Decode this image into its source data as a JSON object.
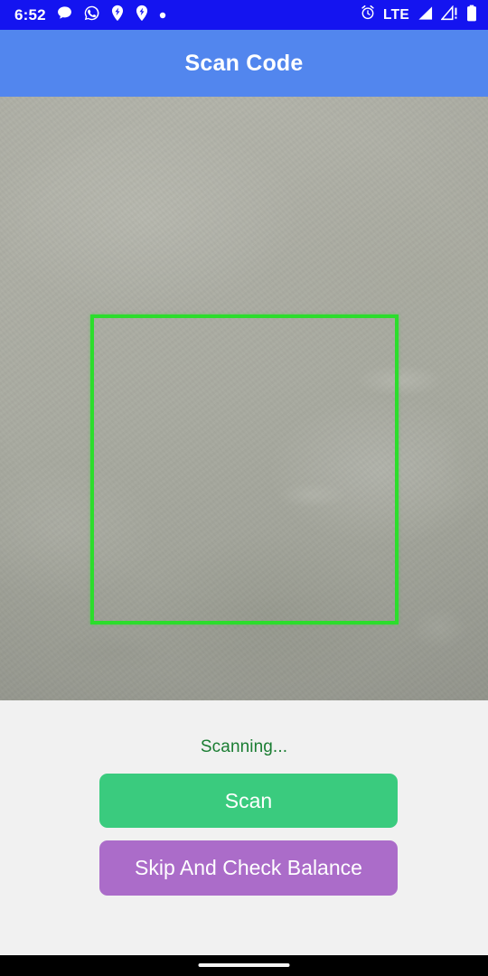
{
  "status_bar": {
    "clock": "6:52",
    "network_label": "LTE",
    "background_color": "#1414f0",
    "left_icons": [
      {
        "name": "chat-bubble-icon",
        "glyph": "chat"
      },
      {
        "name": "whatsapp-icon",
        "glyph": "whatsapp"
      },
      {
        "name": "app-notification-icon-1",
        "glyph": "pin-bolt"
      },
      {
        "name": "app-notification-icon-2",
        "glyph": "pin-bolt"
      },
      {
        "name": "more-notifications-dot-icon",
        "glyph": "dot"
      }
    ],
    "right_icons": [
      {
        "name": "alarm-clock-icon",
        "glyph": "alarm"
      },
      {
        "name": "signal-bars-icon",
        "glyph": "signal-full"
      },
      {
        "name": "signal-no-service-icon",
        "glyph": "signal-alert"
      },
      {
        "name": "battery-icon",
        "glyph": "battery-full"
      }
    ]
  },
  "app_bar": {
    "title": "Scan Code",
    "background_color": "#5286ee",
    "title_color": "#ffffff"
  },
  "camera": {
    "scan_frame_color": "#2cdd2c"
  },
  "controls": {
    "status_text": "Scanning...",
    "status_color": "#1a7d32",
    "panel_background": "#f1f1f1",
    "scan_button": {
      "label": "Scan",
      "color": "#3acb7e",
      "text_color": "#ffffff"
    },
    "skip_button": {
      "label": "Skip And Check Balance",
      "color": "#ab6cc9",
      "text_color": "#ffffff"
    }
  },
  "nav_bar": {
    "background_color": "#000000",
    "pill_color": "#f4f4f4"
  }
}
